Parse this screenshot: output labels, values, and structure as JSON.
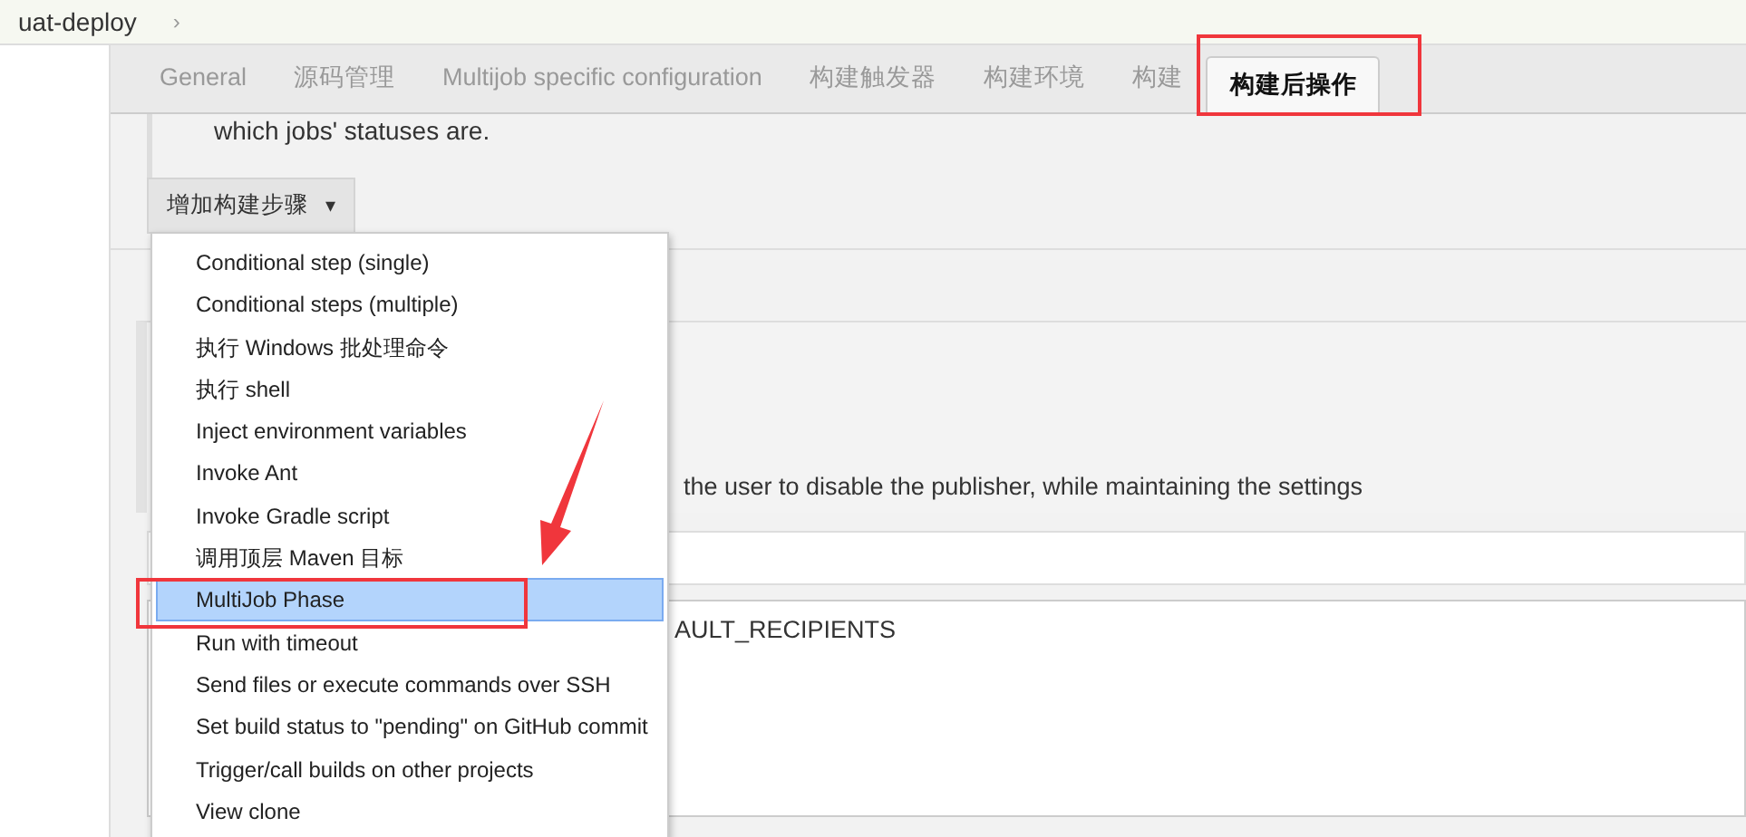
{
  "breadcrumb": {
    "items": [
      "uat-deploy"
    ],
    "separator": "›"
  },
  "tabs": [
    {
      "label": "General",
      "selected": false,
      "callout": false
    },
    {
      "label": "源码管理",
      "selected": false,
      "callout": false
    },
    {
      "label": "Multijob specific configuration",
      "selected": false,
      "callout": false
    },
    {
      "label": "构建触发器",
      "selected": false,
      "callout": false
    },
    {
      "label": "构建环境",
      "selected": false,
      "callout": false
    },
    {
      "label": "构建",
      "selected": false,
      "callout": false
    },
    {
      "label": "构建后操作",
      "selected": true,
      "callout": true
    }
  ],
  "section_text": "which jobs' statuses are.",
  "add_step_button": {
    "label": "增加构建步骤",
    "caret": "▾"
  },
  "menu": [
    {
      "label": "Conditional step (single)",
      "selected": false,
      "callout": false
    },
    {
      "label": "Conditional steps (multiple)",
      "selected": false,
      "callout": false
    },
    {
      "label": "执行 Windows 批处理命令",
      "selected": false,
      "callout": false
    },
    {
      "label": "执行 shell",
      "selected": false,
      "callout": false
    },
    {
      "label": "Inject environment variables",
      "selected": false,
      "callout": false
    },
    {
      "label": "Invoke Ant",
      "selected": false,
      "callout": false
    },
    {
      "label": "Invoke Gradle script",
      "selected": false,
      "callout": false
    },
    {
      "label": "调用顶层 Maven 目标",
      "selected": false,
      "callout": false
    },
    {
      "label": "MultiJob Phase",
      "selected": true,
      "callout": true
    },
    {
      "label": "Run with timeout",
      "selected": false,
      "callout": false
    },
    {
      "label": "Send files or execute commands over SSH",
      "selected": false,
      "callout": false
    },
    {
      "label": "Set build status to \"pending\" on GitHub commit",
      "selected": false,
      "callout": false
    },
    {
      "label": "Trigger/call builds on other projects",
      "selected": false,
      "callout": false
    },
    {
      "label": "View clone",
      "selected": false,
      "callout": false
    }
  ],
  "publisher_help": "the user to disable the publisher, while maintaining the settings",
  "recipients_text": "AULT_RECIPIENTS"
}
